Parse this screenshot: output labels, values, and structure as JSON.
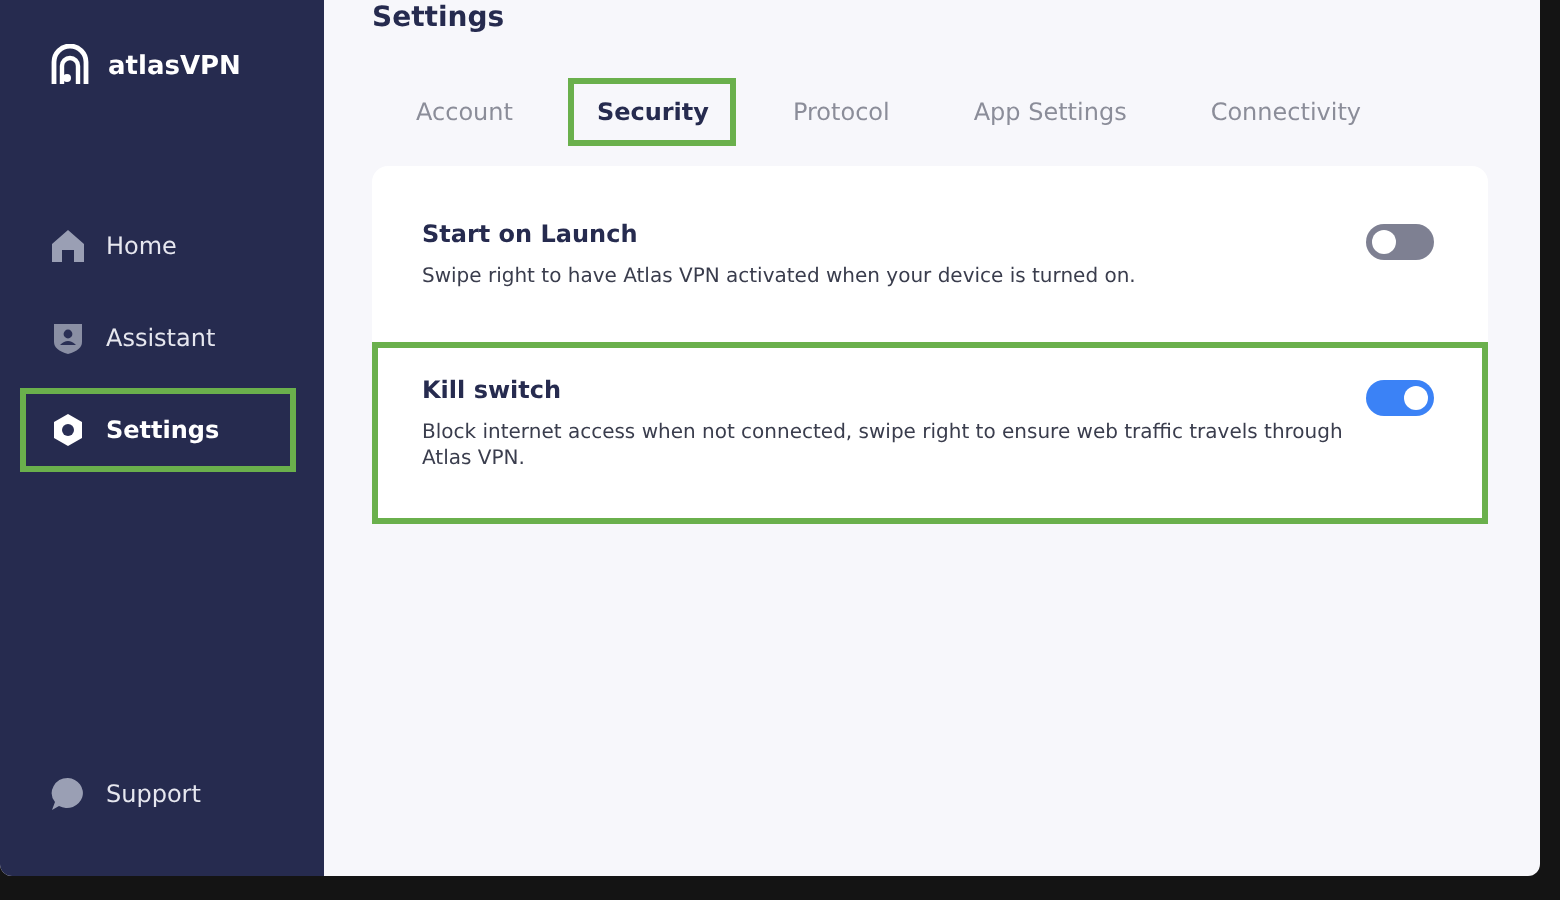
{
  "app": {
    "name": "atlasVPN"
  },
  "nav": [
    {
      "label": "Home",
      "kind": "home",
      "selected": false,
      "highlighted": false
    },
    {
      "label": "Assistant",
      "kind": "assistant",
      "selected": false,
      "highlighted": false
    },
    {
      "label": "Settings",
      "kind": "settings",
      "selected": true,
      "highlighted": true
    }
  ],
  "support": {
    "label": "Support"
  },
  "page_title": "Settings",
  "tabs": [
    {
      "label": "Account",
      "selected": false,
      "highlighted": false
    },
    {
      "label": "Security",
      "selected": true,
      "highlighted": true
    },
    {
      "label": "Protocol",
      "selected": false,
      "highlighted": false
    },
    {
      "label": "App Settings",
      "selected": false,
      "highlighted": false
    },
    {
      "label": "Connectivity",
      "selected": false,
      "highlighted": false
    }
  ],
  "settings": [
    {
      "title": "Start on Launch",
      "description": "Swipe right to have Atlas VPN activated when your device is turned on.",
      "on": false,
      "highlighted": false
    },
    {
      "title": "Kill switch",
      "description": "Block internet access when not connected, swipe right to ensure web traffic travels through Atlas VPN.",
      "on": true,
      "highlighted": true
    }
  ]
}
